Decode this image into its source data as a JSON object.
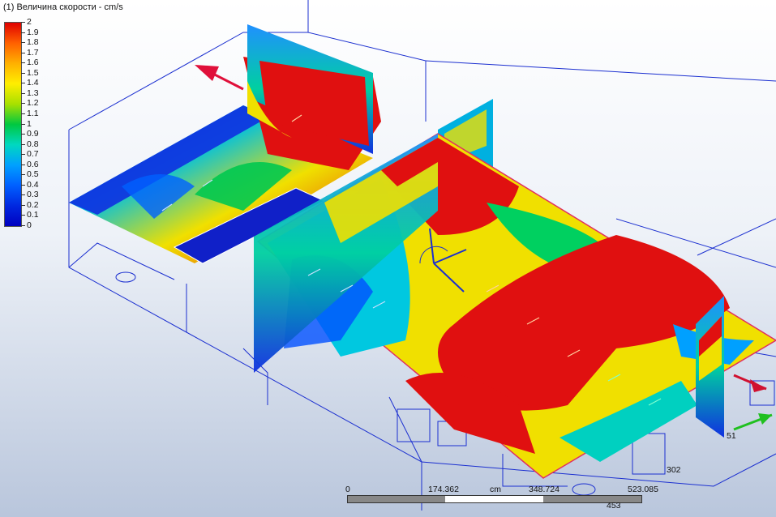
{
  "legend": {
    "title": "(1) Величина скорости - cm/s",
    "ticks": [
      "2",
      "1.9",
      "1.8",
      "1.7",
      "1.6",
      "1.5",
      "1.4",
      "1.3",
      "1.2",
      "1.1",
      "1",
      "0.9",
      "0.8",
      "0.7",
      "0.6",
      "0.5",
      "0.4",
      "0.3",
      "0.2",
      "0.1",
      "0"
    ]
  },
  "scale_bar": {
    "labels": [
      "0",
      "174.362",
      "cm",
      "348.724",
      "523.085"
    ]
  },
  "dimensions": {
    "d1": "51",
    "d2": "302",
    "d3": "453"
  },
  "colors": {
    "high": "#e00000",
    "mid": "#00c840",
    "low": "#0000c0",
    "outline": "#1b2fd0"
  }
}
